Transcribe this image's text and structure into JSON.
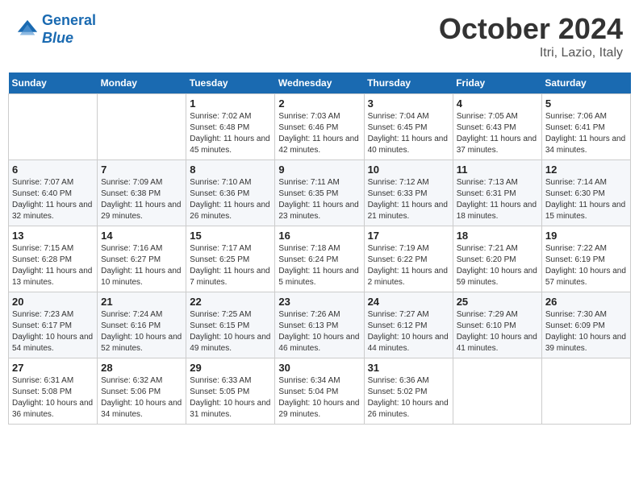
{
  "header": {
    "logo_line1": "General",
    "logo_line2": "Blue",
    "month_title": "October 2024",
    "location": "Itri, Lazio, Italy"
  },
  "weekdays": [
    "Sunday",
    "Monday",
    "Tuesday",
    "Wednesday",
    "Thursday",
    "Friday",
    "Saturday"
  ],
  "weeks": [
    [
      {
        "day": "",
        "info": ""
      },
      {
        "day": "",
        "info": ""
      },
      {
        "day": "1",
        "info": "Sunrise: 7:02 AM\nSunset: 6:48 PM\nDaylight: 11 hours and 45 minutes."
      },
      {
        "day": "2",
        "info": "Sunrise: 7:03 AM\nSunset: 6:46 PM\nDaylight: 11 hours and 42 minutes."
      },
      {
        "day": "3",
        "info": "Sunrise: 7:04 AM\nSunset: 6:45 PM\nDaylight: 11 hours and 40 minutes."
      },
      {
        "day": "4",
        "info": "Sunrise: 7:05 AM\nSunset: 6:43 PM\nDaylight: 11 hours and 37 minutes."
      },
      {
        "day": "5",
        "info": "Sunrise: 7:06 AM\nSunset: 6:41 PM\nDaylight: 11 hours and 34 minutes."
      }
    ],
    [
      {
        "day": "6",
        "info": "Sunrise: 7:07 AM\nSunset: 6:40 PM\nDaylight: 11 hours and 32 minutes."
      },
      {
        "day": "7",
        "info": "Sunrise: 7:09 AM\nSunset: 6:38 PM\nDaylight: 11 hours and 29 minutes."
      },
      {
        "day": "8",
        "info": "Sunrise: 7:10 AM\nSunset: 6:36 PM\nDaylight: 11 hours and 26 minutes."
      },
      {
        "day": "9",
        "info": "Sunrise: 7:11 AM\nSunset: 6:35 PM\nDaylight: 11 hours and 23 minutes."
      },
      {
        "day": "10",
        "info": "Sunrise: 7:12 AM\nSunset: 6:33 PM\nDaylight: 11 hours and 21 minutes."
      },
      {
        "day": "11",
        "info": "Sunrise: 7:13 AM\nSunset: 6:31 PM\nDaylight: 11 hours and 18 minutes."
      },
      {
        "day": "12",
        "info": "Sunrise: 7:14 AM\nSunset: 6:30 PM\nDaylight: 11 hours and 15 minutes."
      }
    ],
    [
      {
        "day": "13",
        "info": "Sunrise: 7:15 AM\nSunset: 6:28 PM\nDaylight: 11 hours and 13 minutes."
      },
      {
        "day": "14",
        "info": "Sunrise: 7:16 AM\nSunset: 6:27 PM\nDaylight: 11 hours and 10 minutes."
      },
      {
        "day": "15",
        "info": "Sunrise: 7:17 AM\nSunset: 6:25 PM\nDaylight: 11 hours and 7 minutes."
      },
      {
        "day": "16",
        "info": "Sunrise: 7:18 AM\nSunset: 6:24 PM\nDaylight: 11 hours and 5 minutes."
      },
      {
        "day": "17",
        "info": "Sunrise: 7:19 AM\nSunset: 6:22 PM\nDaylight: 11 hours and 2 minutes."
      },
      {
        "day": "18",
        "info": "Sunrise: 7:21 AM\nSunset: 6:20 PM\nDaylight: 10 hours and 59 minutes."
      },
      {
        "day": "19",
        "info": "Sunrise: 7:22 AM\nSunset: 6:19 PM\nDaylight: 10 hours and 57 minutes."
      }
    ],
    [
      {
        "day": "20",
        "info": "Sunrise: 7:23 AM\nSunset: 6:17 PM\nDaylight: 10 hours and 54 minutes."
      },
      {
        "day": "21",
        "info": "Sunrise: 7:24 AM\nSunset: 6:16 PM\nDaylight: 10 hours and 52 minutes."
      },
      {
        "day": "22",
        "info": "Sunrise: 7:25 AM\nSunset: 6:15 PM\nDaylight: 10 hours and 49 minutes."
      },
      {
        "day": "23",
        "info": "Sunrise: 7:26 AM\nSunset: 6:13 PM\nDaylight: 10 hours and 46 minutes."
      },
      {
        "day": "24",
        "info": "Sunrise: 7:27 AM\nSunset: 6:12 PM\nDaylight: 10 hours and 44 minutes."
      },
      {
        "day": "25",
        "info": "Sunrise: 7:29 AM\nSunset: 6:10 PM\nDaylight: 10 hours and 41 minutes."
      },
      {
        "day": "26",
        "info": "Sunrise: 7:30 AM\nSunset: 6:09 PM\nDaylight: 10 hours and 39 minutes."
      }
    ],
    [
      {
        "day": "27",
        "info": "Sunrise: 6:31 AM\nSunset: 5:08 PM\nDaylight: 10 hours and 36 minutes."
      },
      {
        "day": "28",
        "info": "Sunrise: 6:32 AM\nSunset: 5:06 PM\nDaylight: 10 hours and 34 minutes."
      },
      {
        "day": "29",
        "info": "Sunrise: 6:33 AM\nSunset: 5:05 PM\nDaylight: 10 hours and 31 minutes."
      },
      {
        "day": "30",
        "info": "Sunrise: 6:34 AM\nSunset: 5:04 PM\nDaylight: 10 hours and 29 minutes."
      },
      {
        "day": "31",
        "info": "Sunrise: 6:36 AM\nSunset: 5:02 PM\nDaylight: 10 hours and 26 minutes."
      },
      {
        "day": "",
        "info": ""
      },
      {
        "day": "",
        "info": ""
      }
    ]
  ]
}
